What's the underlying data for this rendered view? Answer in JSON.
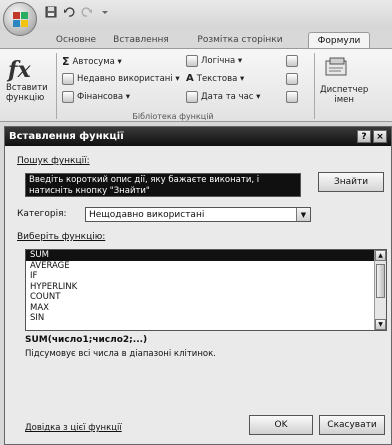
{
  "quick_access": {
    "icons": [
      "save-icon",
      "undo-icon",
      "redo-icon",
      "customize-icon"
    ]
  },
  "tabs": [
    {
      "label": "Основне"
    },
    {
      "label": "Вставлення"
    },
    {
      "label": "Розмітка сторінки"
    },
    {
      "label": "Формули",
      "active": true
    }
  ],
  "ribbon": {
    "insert_function_line1": "Вставити",
    "insert_function_line2": "функцію",
    "autosum": "Автосума ▾",
    "recent": "Недавно використані ▾",
    "financial": "Фінансова ▾",
    "logical": "Логічна ▾",
    "text": "Текстова ▾",
    "datetime": "Дата та час ▾",
    "group_label": "Бібліотека функцій",
    "name_manager_line1": "Диспетчер",
    "name_manager_line2": "імен"
  },
  "dialog": {
    "title": "Вставлення функції",
    "help_btn": "?",
    "close_btn": "×",
    "search_label": "Пошук функції:",
    "search_value": "Введіть короткий опис дії, яку бажаєте виконати, і натисніть кнопку \"Знайти\"",
    "find_button": "Знайти",
    "category_label": "Категорія:",
    "category_value": "Нещодавно використані",
    "select_label": "Виберіть функцію:",
    "functions": [
      "SUM",
      "AVERAGE",
      "IF",
      "HYPERLINK",
      "COUNT",
      "MAX",
      "SIN"
    ],
    "selected_index": 0,
    "syntax": "SUM(число1;число2;...)",
    "description": "Підсумовує всі числа в діапазоні клітинок.",
    "help_link": "Довідка з цієї функції",
    "ok_button": "OK",
    "cancel_button": "Скасувати"
  }
}
